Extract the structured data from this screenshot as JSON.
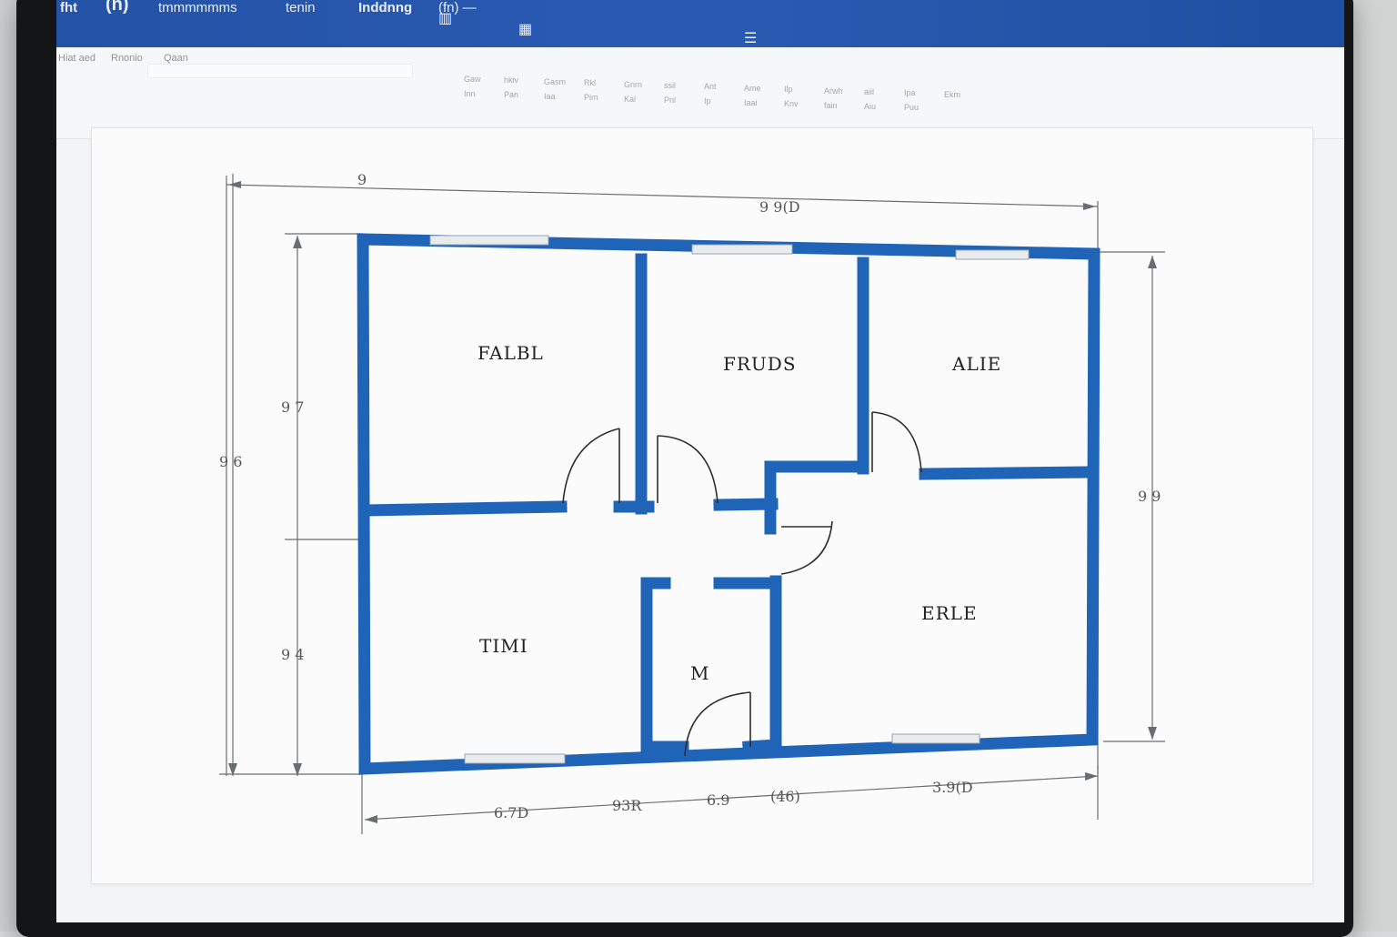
{
  "window": {
    "app_label": "fht",
    "logo": "(n)",
    "title_menus": [
      "tmmmmmms",
      "tenin",
      "Inddnng"
    ],
    "doc_name": "(fn) —",
    "ribbon_tabs": [
      "Hiat aed",
      "Rnonio",
      "Qaan"
    ],
    "icons": [
      "bar-chart-icon",
      "grid-icon",
      "table-icon",
      "settings-icon",
      "account-icon",
      "window-icon"
    ]
  },
  "ribbon": {
    "cells": [
      "Gaw",
      "hkiv",
      "Gasm",
      "Rkl",
      "Gnrn",
      "ssil",
      "Ant",
      "Ame",
      "Ilp",
      "Arwh",
      "aiil",
      "Ipa",
      "Ekm",
      "Inn",
      "Pan",
      "Iaa",
      "Pim",
      "Kal",
      "Pnl",
      "Ip",
      "Iaai",
      "Knv",
      "fain",
      "Aiu",
      "Puu"
    ]
  },
  "floorplan": {
    "rooms": [
      "FALBL",
      "FRUDS",
      "ALIE",
      "TIMI",
      "M",
      "ERLE"
    ],
    "dimensions": {
      "top_total": "9 9(D",
      "top_small": "9",
      "left_outer": "9 6",
      "left_upper": "9 7",
      "left_lower": "9 4",
      "right": "9 9",
      "bottom_1": "6.7D",
      "bottom_2": "93R",
      "bottom_3": "6.9",
      "bottom_4": "(46)",
      "bottom_total": "3.9(D"
    },
    "colors": {
      "wall": "#1f64b7",
      "dimension": "#6a6d70"
    }
  }
}
